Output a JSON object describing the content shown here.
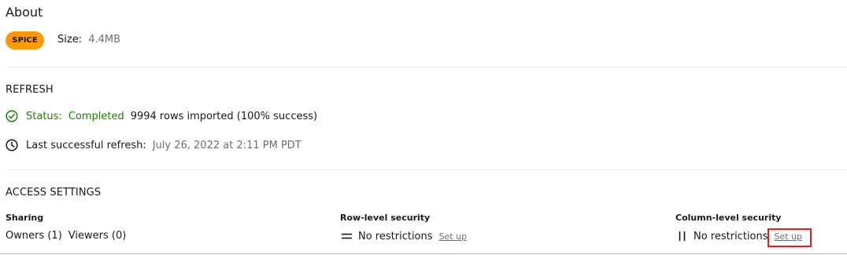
{
  "about": {
    "title": "About",
    "badge": "SPICE",
    "size_label": "Size:",
    "size_value": "4.4MB"
  },
  "refresh": {
    "section_title": "REFRESH",
    "status_label": "Status:",
    "status_value": "Completed",
    "status_detail": "9994 rows imported (100% success)",
    "last_refresh_label": "Last successful refresh:",
    "last_refresh_value": "July 26, 2022 at 2:11 PM PDT",
    "icons": {
      "status": "check-circle-icon",
      "last_refresh": "clock-icon"
    }
  },
  "access": {
    "section_title": "ACCESS SETTINGS",
    "sharing": {
      "heading": "Sharing",
      "owners": "Owners (1)",
      "viewers": "Viewers (0)"
    },
    "row_level": {
      "heading": "Row-level security",
      "value": "No restrictions",
      "link": "Set up",
      "icon": "rows-icon"
    },
    "column_level": {
      "heading": "Column-level security",
      "value": "No restrictions",
      "link": "Set up",
      "icon": "columns-icon"
    }
  },
  "colors": {
    "badge": "#ff9900",
    "success": "#1d8102",
    "highlight": "#e0201b"
  }
}
